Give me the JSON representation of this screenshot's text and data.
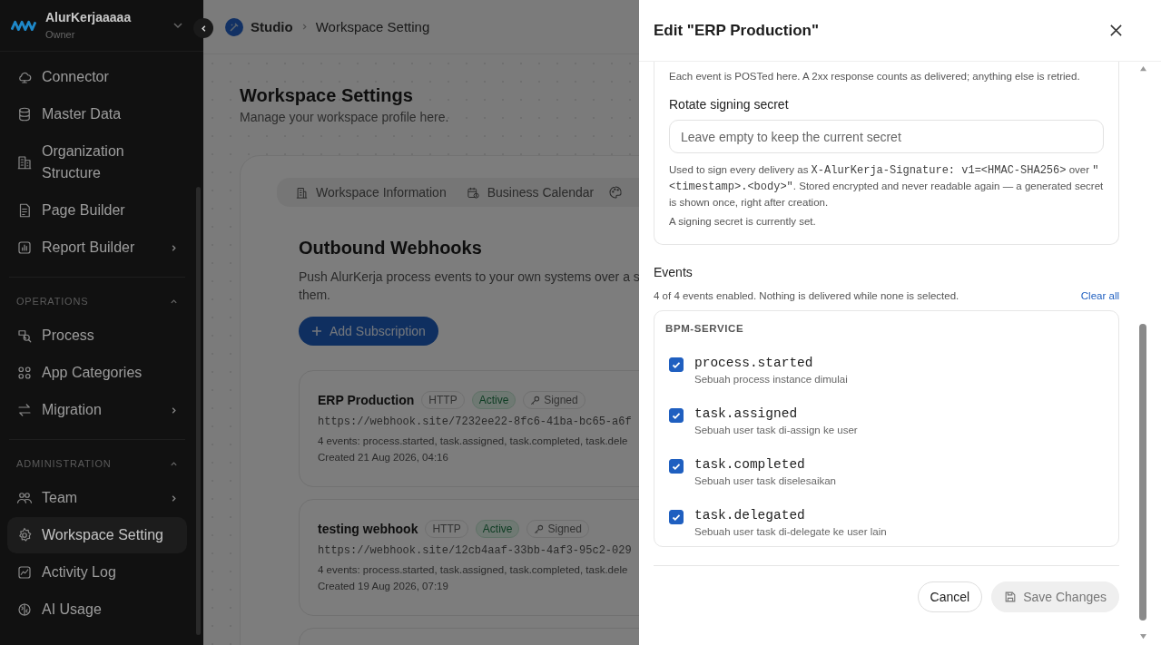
{
  "sidebar": {
    "workspace": {
      "name": "AlurKerjaaaaa",
      "role": "Owner"
    },
    "groups": [
      {
        "items": [
          {
            "label": "Connector",
            "has_submenu": false,
            "selected": false
          },
          {
            "label": "Master Data",
            "has_submenu": false,
            "selected": false
          },
          {
            "label": "Organization Structure",
            "has_submenu": false,
            "selected": false
          },
          {
            "label": "Page Builder",
            "has_submenu": false,
            "selected": false
          },
          {
            "label": "Report Builder",
            "has_submenu": true,
            "selected": false
          }
        ]
      },
      {
        "title": "OPERATIONS",
        "expanded": true,
        "items": [
          {
            "label": "Process",
            "has_submenu": false,
            "selected": false
          },
          {
            "label": "App Categories",
            "has_submenu": false,
            "selected": false
          },
          {
            "label": "Migration",
            "has_submenu": true,
            "selected": false
          }
        ]
      },
      {
        "title": "ADMINISTRATION",
        "expanded": true,
        "items": [
          {
            "label": "Team",
            "has_submenu": true,
            "selected": false
          },
          {
            "label": "Workspace Setting",
            "has_submenu": false,
            "selected": true
          },
          {
            "label": "Activity Log",
            "has_submenu": false,
            "selected": false
          },
          {
            "label": "AI Usage",
            "has_submenu": false,
            "selected": false
          }
        ]
      }
    ]
  },
  "breadcrumb": [
    "Studio",
    "Workspace Setting"
  ],
  "page": {
    "title": "Workspace Settings",
    "subtitle": "Manage your workspace profile here."
  },
  "tabs": [
    {
      "label": "Workspace Information",
      "selected": false
    },
    {
      "label": "Business Calendar",
      "selected": false
    }
  ],
  "webhooks": {
    "title": "Outbound Webhooks",
    "description_lines": [
      "Push AlurKerja process events to your own systems over a s",
      "them."
    ],
    "add_button": "Add Subscription",
    "subscriptions": [
      {
        "name": "ERP Production",
        "protocol": "HTTP",
        "active": true,
        "status": "Active",
        "signed": true,
        "signed_label": "Signed",
        "url": "https://webhook.site/7232ee22-8fc6-41ba-bc65-a6f",
        "events": "4 events: process.started, task.assigned, task.completed, task.dele",
        "created": "Created 21 Aug 2026, 04:16"
      },
      {
        "name": "testing webhook",
        "protocol": "HTTP",
        "active": true,
        "status": "Active",
        "signed": true,
        "signed_label": "Signed",
        "url": "https://webhook.site/12cb4aaf-33bb-4af3-95c2-029",
        "events": "4 events: process.started, task.assigned, task.completed, task.dele",
        "created": "Created 19 Aug 2026, 07:19"
      }
    ]
  },
  "drawer": {
    "title": "Edit \"ERP Production\"",
    "endpoint_help": "Each event is POSTed here. A 2xx response counts as delivered; anything else is retried.",
    "secret": {
      "label": "Rotate signing secret",
      "placeholder": "Leave empty to keep the current secret",
      "help": [
        {
          "kind": "text",
          "text": "Used to sign every delivery as "
        },
        {
          "kind": "code",
          "text": "X-AlurKerja-Signature: v1=<HMAC-SHA256>"
        },
        {
          "kind": "text",
          "text": " over "
        },
        {
          "kind": "code",
          "text": "\"<timestamp>.<body>\""
        },
        {
          "kind": "text",
          "text": ". Stored encrypted and never readable again — a generated secret is shown once, right after creation."
        }
      ],
      "note": "A signing secret is currently set."
    },
    "events": {
      "title": "Events",
      "summary": "4 of 4 events enabled. Nothing is delivered while none is selected.",
      "clear_label": "Clear all",
      "groups": [
        {
          "title": "BPM-SERVICE",
          "items": [
            {
              "name": "process.started",
              "description": "Sebuah process instance dimulai",
              "checked": true
            },
            {
              "name": "task.assigned",
              "description": "Sebuah user task di-assign ke user",
              "checked": true
            },
            {
              "name": "task.completed",
              "description": "Sebuah user task diselesaikan",
              "checked": true
            },
            {
              "name": "task.delegated",
              "description": "Sebuah user task di-delegate ke user lain",
              "checked": true
            }
          ]
        }
      ]
    },
    "footer": {
      "cancel": "Cancel",
      "save": "Save Changes",
      "save_disabled": true
    }
  }
}
